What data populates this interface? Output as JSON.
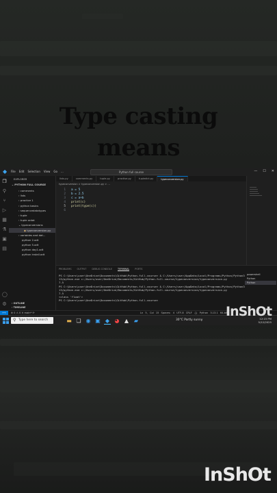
{
  "overlay": {
    "title_line1": "Type casting",
    "title_line2": "means",
    "watermark": "InShOt"
  },
  "window": {
    "menu": [
      "File",
      "Edit",
      "Selection",
      "View",
      "Go",
      "..."
    ],
    "command_center": "Python full course",
    "controls": [
      "—",
      "☐",
      "✕"
    ]
  },
  "activity_icons": [
    "files-icon",
    "search-icon",
    "source-control-icon",
    "run-debug-icon",
    "extensions-icon",
    "testing-icon",
    "remote-icon",
    "docker-icon",
    "accounts-icon",
    "settings-icon"
  ],
  "explorer": {
    "header": "EXPLORER",
    "folder": "PYTHON FULL COURSE",
    "items": [
      {
        "label": "comments",
        "selected": false
      },
      {
        "label": "lists",
        "selected": false
      },
      {
        "label": "practice 1",
        "selected": false
      },
      {
        "label": "python basics",
        "selected": false
      },
      {
        "label": "sequencedatatypes",
        "selected": false
      },
      {
        "label": "tuple",
        "selected": false
      },
      {
        "label": "tuple ordat",
        "selected": false
      },
      {
        "label": "typeconversions",
        "selected": false
      },
      {
        "label": "typeconversion.py",
        "selected": true
      },
      {
        "label": "variables and dat...",
        "selected": false
      },
      {
        "label": "python 2.odt",
        "selected": false
      },
      {
        "label": "python 5.odt",
        "selected": false
      },
      {
        "label": "python day1.odt",
        "selected": false
      },
      {
        "label": "python install.odt",
        "selected": false
      }
    ],
    "outline": "OUTLINE",
    "timeline": "TIMELINE"
  },
  "editor": {
    "tabs": [
      {
        "label": "lists.py",
        "active": false
      },
      {
        "label": "comments.py",
        "active": false
      },
      {
        "label": "tuple.py",
        "active": false
      },
      {
        "label": "practise.py",
        "active": false
      },
      {
        "label": "tupledict.py",
        "active": false
      },
      {
        "label": "typeconversion.py",
        "active": true
      }
    ],
    "breadcrumb": "typeconversion > typeconversion.py > ...",
    "lines": [
      {
        "num": "1",
        "code": "a = 5"
      },
      {
        "num": "2",
        "code": "b = 2.5"
      },
      {
        "num": "3",
        "code": "c = a+b"
      },
      {
        "num": "4",
        "code": "print(c)"
      },
      {
        "num": "5",
        "code": "print(type(c))"
      },
      {
        "num": "6",
        "code": ""
      }
    ]
  },
  "panel": {
    "tabs": [
      {
        "label": "PROBLEMS",
        "active": false
      },
      {
        "label": "OUTPUT",
        "active": false
      },
      {
        "label": "DEBUG CONSOLE",
        "active": false
      },
      {
        "label": "TERMINAL",
        "active": true
      },
      {
        "label": "PORTS",
        "active": false
      }
    ],
    "terminal_lines": [
      "PS C:\\Users\\user\\OneDrive\\Documents\\GitHub\\Python-full-course> & C:/Users/user/AppData/Local/Programs/Python/Python313/python.exe c:/Users/user/OneDrive/Documents/GitHub/Python-full-course/typeconversion/typeconversion.py",
      "7.5",
      "PS C:\\Users\\user\\OneDrive\\Documents\\GitHub\\Python-full-course> & C:/Users/user/AppData/Local/Programs/Python/Python313/python.exe c:/Users/user/OneDrive/Documents/GitHub/Python-full-course/typeconversion/typeconversion.py",
      "7.5",
      "<class 'float'>",
      "PS C:\\Users\\user\\OneDrive\\Documents\\GitHub\\Python-full-course>"
    ],
    "terminal_list": [
      {
        "label": "powershell",
        "selected": false
      },
      {
        "label": "Python",
        "selected": false
      },
      {
        "label": "Python",
        "selected": true
      }
    ]
  },
  "statusbar": {
    "left": "⊗ 0 ⚠ 0   ✕ main*  ⟳",
    "right": "Ln 5, Col 15  Spaces: 4  UTF-8  CRLF  {} Python  3.13.1 64-bit"
  },
  "taskbar": {
    "search_placeholder": "Type here to search",
    "weather": "30°C  Partly sunny",
    "time": "12:15 PM",
    "date": "5/12/2025"
  }
}
